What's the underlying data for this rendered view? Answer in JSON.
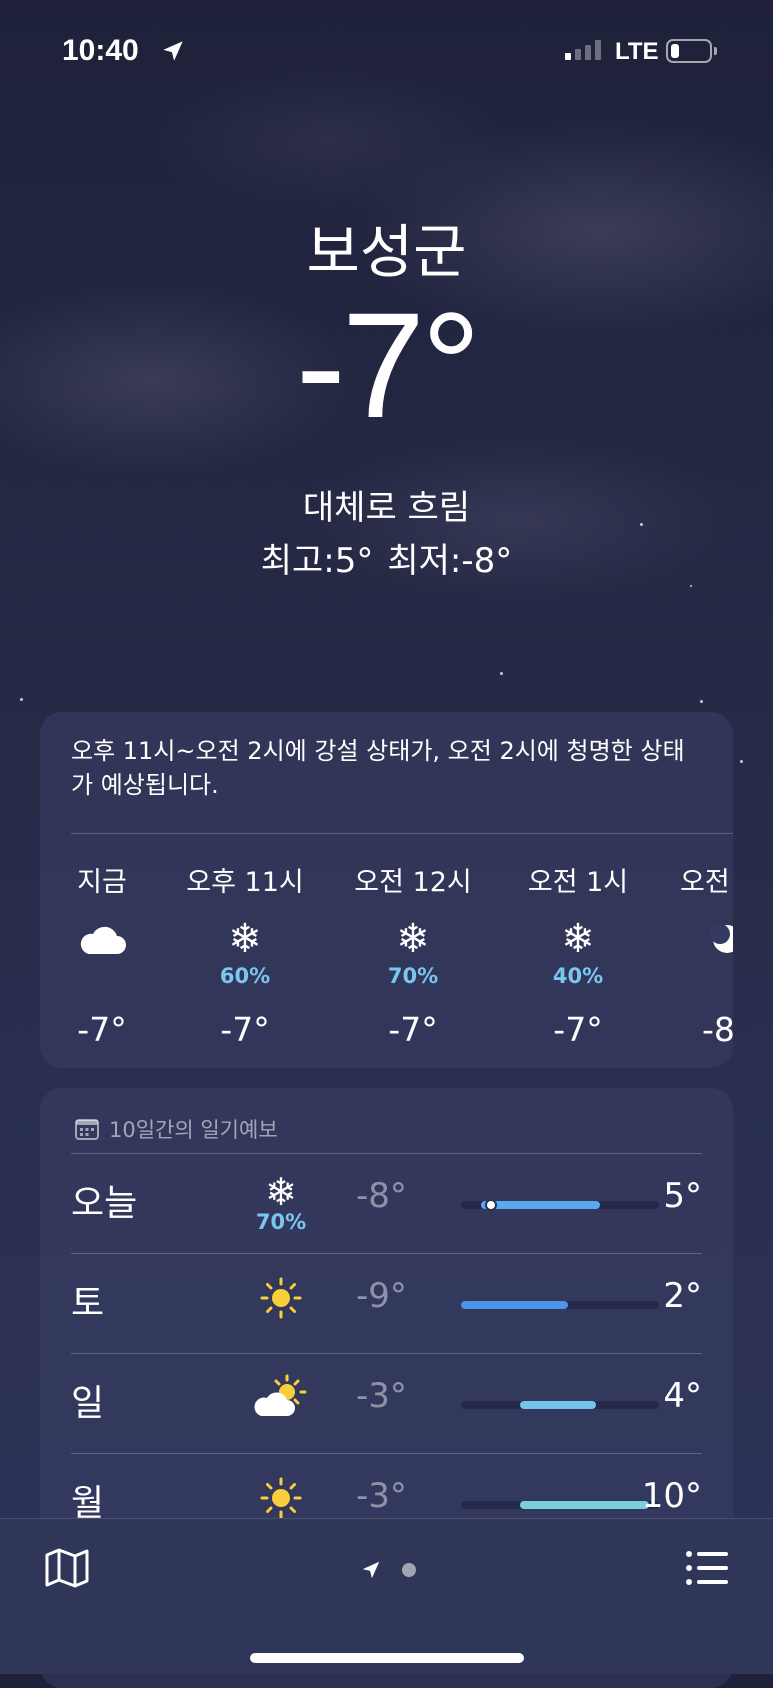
{
  "status_bar": {
    "time": "10:40",
    "network": "LTE",
    "icons": [
      "location-arrow-icon",
      "signal-icon",
      "battery-icon"
    ]
  },
  "location": {
    "city": "보성군",
    "temperature": "-7°",
    "condition": "대체로 흐림",
    "high": "최고:5°",
    "low": "최저:-8°"
  },
  "hourly": {
    "summary": "오후 11시~오전 2시에 강설 상태가, 오전 2시에 청명한 상태가 예상됩니다.",
    "items": [
      {
        "label": "지금",
        "icon": "cloud-icon",
        "precip": "",
        "temp": "-7°"
      },
      {
        "label": "오후 11시",
        "icon": "snowflake-icon",
        "precip": "60%",
        "temp": "-7°"
      },
      {
        "label": "오전 12시",
        "icon": "snowflake-icon",
        "precip": "70%",
        "temp": "-7°"
      },
      {
        "label": "오전 1시",
        "icon": "snowflake-icon",
        "precip": "40%",
        "temp": "-7°"
      },
      {
        "label": "오전",
        "icon": "moon-icon",
        "precip": "",
        "temp": "-8"
      }
    ]
  },
  "daily": {
    "header": "10일간의 일기예보",
    "days": [
      {
        "day": "오늘",
        "icon": "snowflake-icon",
        "precip": "70%",
        "low": "-8°",
        "high": "5°",
        "bar_start": 0.1,
        "bar_end": 0.7,
        "current_dot": 0.15,
        "bar_color": "#5aa9ef"
      },
      {
        "day": "토",
        "icon": "sun-icon",
        "precip": "",
        "low": "-9°",
        "high": "2°",
        "bar_start": 0.0,
        "bar_end": 0.54,
        "bar_color": "#4d93ea"
      },
      {
        "day": "일",
        "icon": "partly-sunny-icon",
        "precip": "",
        "low": "-3°",
        "high": "4°",
        "bar_start": 0.3,
        "bar_end": 0.68,
        "bar_color": "#73c3ea"
      },
      {
        "day": "월",
        "icon": "sun-icon",
        "precip": "",
        "low": "-3°",
        "high": "10°",
        "bar_start": 0.3,
        "bar_end": 0.95,
        "bar_color": "#7ccfd8"
      }
    ]
  },
  "bottom_bar": {
    "icons": [
      "map-icon",
      "location-arrow-icon",
      "list-icon"
    ]
  }
}
